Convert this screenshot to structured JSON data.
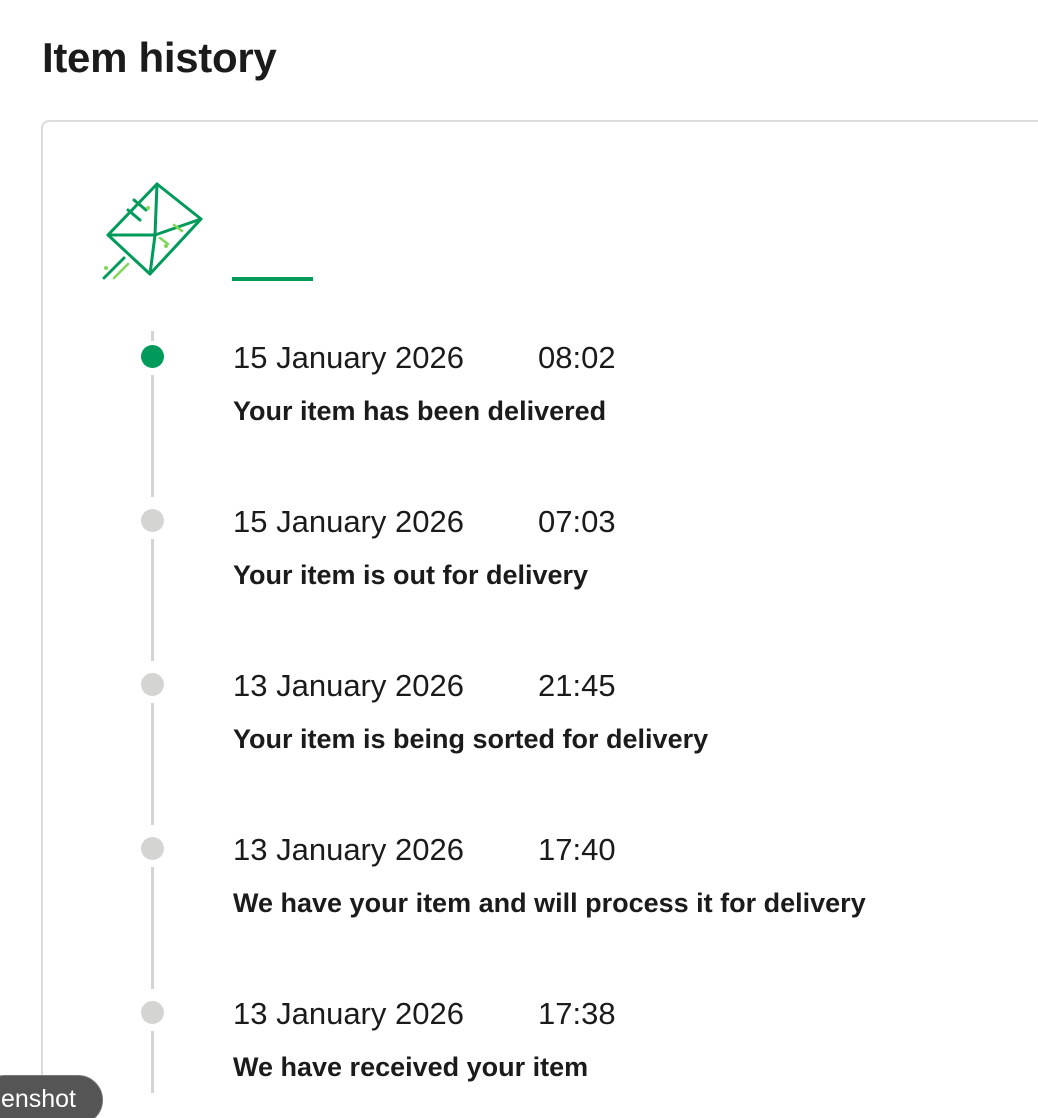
{
  "page": {
    "title": "Item history"
  },
  "icons": {
    "header_icon": "flying-envelope-icon"
  },
  "colors": {
    "accent": "#009a5a",
    "inactive": "#d4d4d2",
    "text": "#1b1b1b"
  },
  "events": [
    {
      "date": "15 January 2026",
      "time": "08:02",
      "description": "Your item has been delivered",
      "active": true
    },
    {
      "date": "15 January 2026",
      "time": "07:03",
      "description": "Your item is out for delivery",
      "active": false
    },
    {
      "date": "13 January 2026",
      "time": "21:45",
      "description": "Your item is being sorted for delivery",
      "active": false
    },
    {
      "date": "13 January 2026",
      "time": "17:40",
      "description": "We have your item and will process it for delivery",
      "active": false
    },
    {
      "date": "13 January 2026",
      "time": "17:38",
      "description": "We have received your item",
      "active": false
    }
  ],
  "overlay": {
    "screenshot_label": "enshot"
  }
}
